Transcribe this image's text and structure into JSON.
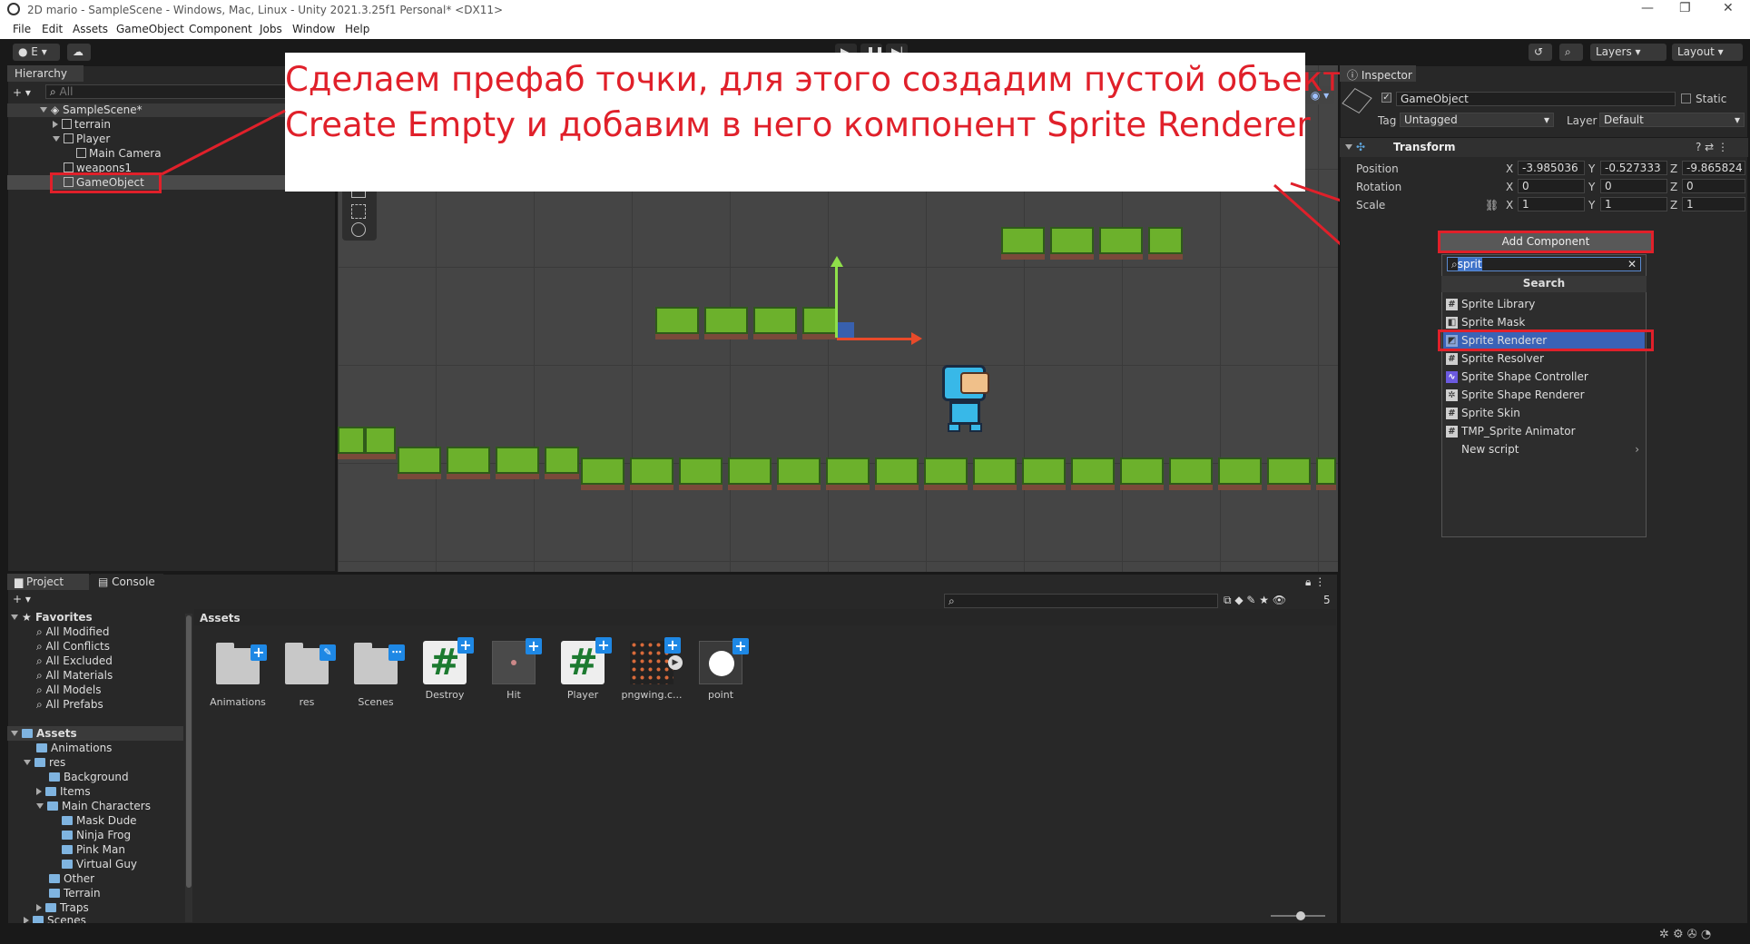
{
  "window": {
    "title": "2D mario - SampleScene - Windows, Mac, Linux - Unity 2021.3.25f1 Personal* <DX11>",
    "min": "—",
    "restore": "❐",
    "close": "✕"
  },
  "menu": [
    "File",
    "Edit",
    "Assets",
    "GameObject",
    "Component",
    "Jobs",
    "Window",
    "Help"
  ],
  "toolbar": {
    "account": "E",
    "layers": "Layers",
    "layout": "Layout"
  },
  "hierarchy": {
    "tab": "Hierarchy",
    "search_placeholder": "All",
    "scene": "SampleScene*",
    "items": [
      "terrain",
      "Player",
      "Main Camera",
      "weapons1",
      "GameObject"
    ]
  },
  "annotation": {
    "line1": "Сделаем префаб точки, для этого создадим пустой объект",
    "line2": "Create Empty и добавим в него компонент Sprite Renderer"
  },
  "inspector": {
    "tab": "Inspector",
    "name": "GameObject",
    "static": "Static",
    "tag_label": "Tag",
    "tag": "Untagged",
    "layer_label": "Layer",
    "layer": "Default",
    "transform": "Transform",
    "position_label": "Position",
    "rotation_label": "Rotation",
    "scale_label": "Scale",
    "x": "X",
    "y": "Y",
    "z": "Z",
    "position": [
      "-3.985036",
      "-0.527333",
      "-9.865824"
    ],
    "rotation": [
      "0",
      "0",
      "0"
    ],
    "scale": [
      "1",
      "1",
      "1"
    ],
    "add_component": "Add Component",
    "search_value": "sprit",
    "search_header": "Search",
    "results": [
      "Sprite Library",
      "Sprite Mask",
      "Sprite Renderer",
      "Sprite Resolver",
      "Sprite Shape Controller",
      "Sprite Shape Renderer",
      "Sprite Skin",
      "TMP_Sprite Animator",
      "New script"
    ]
  },
  "project": {
    "tab_project": "Project",
    "tab_console": "Console",
    "favorites": "Favorites",
    "fav_items": [
      "All Modified",
      "All Conflicts",
      "All Excluded",
      "All Materials",
      "All Models",
      "All Prefabs"
    ],
    "assets": "Assets",
    "tree": [
      "Animations",
      "res",
      "Background",
      "Items",
      "Main Characters",
      "Mask Dude",
      "Ninja Frog",
      "Pink Man",
      "Virtual Guy",
      "Other",
      "Terrain",
      "Traps",
      "Scenes"
    ],
    "breadcrumb": "Assets",
    "hidden_count": "5",
    "files": [
      "Animations",
      "res",
      "Scenes",
      "Destroy",
      "Hit",
      "Player",
      "pngwing.c...",
      "point"
    ]
  }
}
